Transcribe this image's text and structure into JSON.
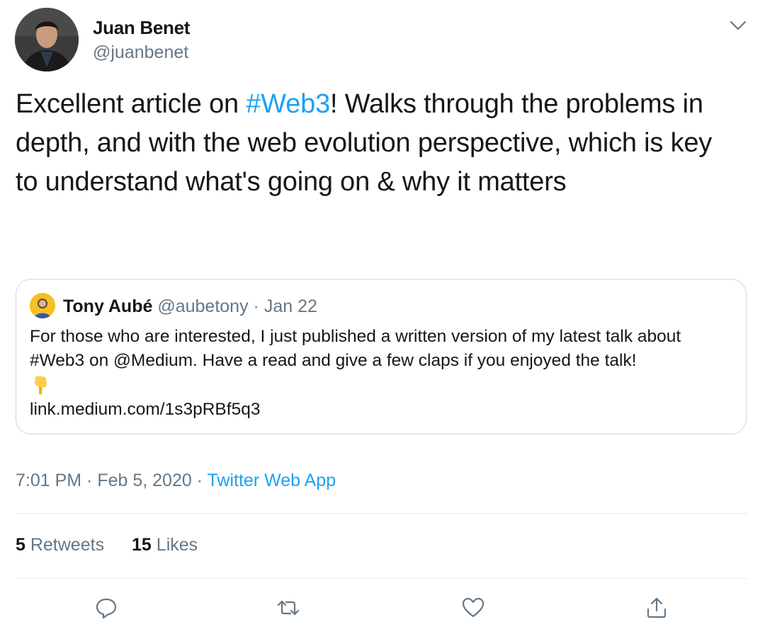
{
  "author": {
    "name": "Juan Benet",
    "handle": "@juanbenet"
  },
  "tweet": {
    "text_before": "Excellent article on ",
    "hashtag": "#Web3",
    "text_after": "! Walks through the problems in depth, and with the web evolution perspective, which is key to understand what's going on & why it matters"
  },
  "quoted": {
    "name": "Tony Aubé",
    "handle": "@aubetony",
    "separator": " · ",
    "date": "Jan 22",
    "body": "For those who are interested, I just published a written version of my latest talk about #Web3 on @Medium. Have a read and give a few claps if you enjoyed the talk!",
    "link": "link.medium.com/1s3pRBf5q3"
  },
  "meta": {
    "time": "7:01 PM",
    "sep1": " · ",
    "date": "Feb 5, 2020",
    "sep2": " · ",
    "source": "Twitter Web App"
  },
  "stats": {
    "retweets_count": "5",
    "retweets_label": " Retweets",
    "likes_count": "15",
    "likes_label": " Likes"
  },
  "icons": {
    "caret": "chevron-down-icon",
    "reply": "reply-icon",
    "retweet": "retweet-icon",
    "like": "heart-icon",
    "share": "share-icon"
  },
  "colors": {
    "link_blue": "#1da1f2",
    "secondary_text": "#657786",
    "primary_text": "#14171a",
    "border": "#ccd6dd"
  }
}
